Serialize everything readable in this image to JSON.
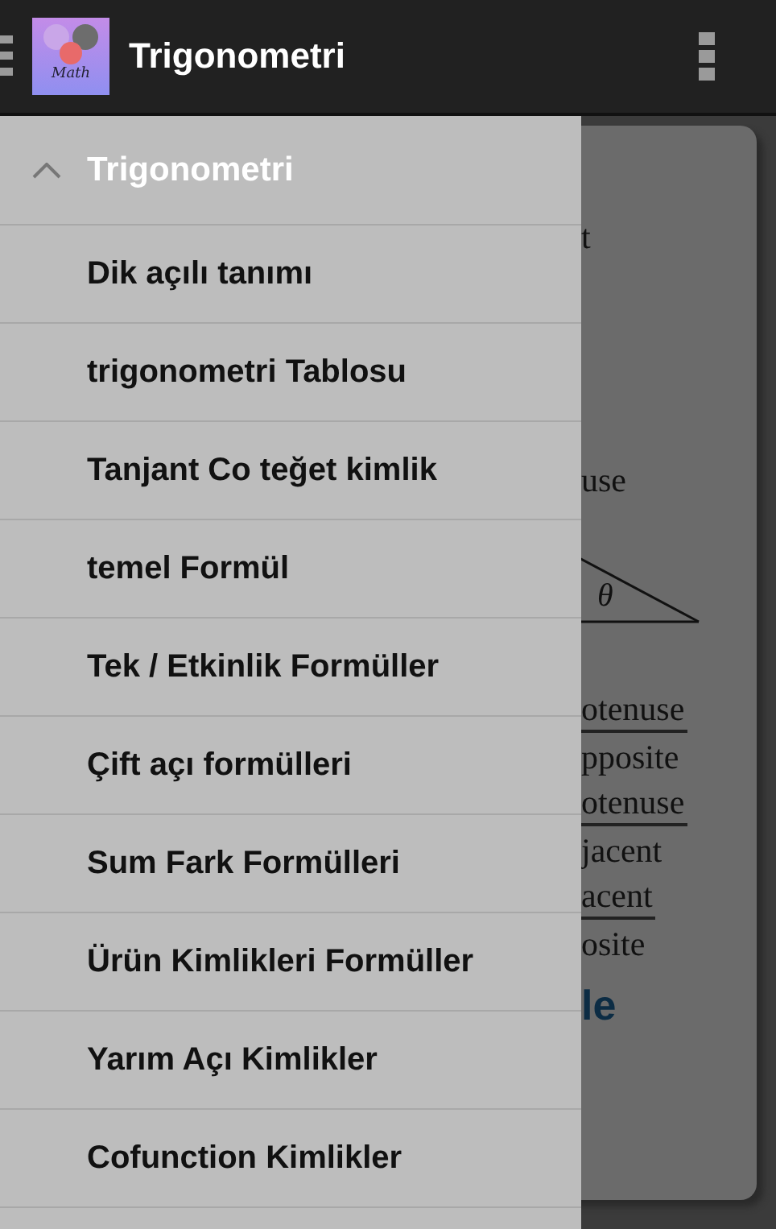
{
  "app_bar": {
    "title": "Trigonometri",
    "logo_text": "Math"
  },
  "drawer": {
    "group": {
      "title": "Trigonometri",
      "expanded": true
    },
    "items": [
      {
        "label": "Dik açılı tanımı"
      },
      {
        "label": "trigonometri Tablosu"
      },
      {
        "label": "Tanjant Co teğet kimlik"
      },
      {
        "label": "temel Formül"
      },
      {
        "label": "Tek / Etkinlik Formüller"
      },
      {
        "label": "Çift açı formülleri"
      },
      {
        "label": "Sum Fark Formülleri"
      },
      {
        "label": "Ürün Kimlikleri Formüller"
      },
      {
        "label": "Yarım Açı Kimlikler"
      },
      {
        "label": "Cofunction Kimlikler"
      }
    ]
  },
  "content_fragments": [
    {
      "text": "t",
      "kind": "plain"
    },
    {
      "text": "use",
      "kind": "plain"
    },
    {
      "text": "θ",
      "kind": "angle"
    },
    {
      "text": "otenuse",
      "kind": "numerator"
    },
    {
      "text": "pposite",
      "kind": "plain"
    },
    {
      "text": "otenuse",
      "kind": "numerator"
    },
    {
      "text": "jacent",
      "kind": "plain"
    },
    {
      "text": "acent",
      "kind": "numerator"
    },
    {
      "text": "osite",
      "kind": "plain"
    },
    {
      "text": "le",
      "kind": "heading"
    }
  ]
}
